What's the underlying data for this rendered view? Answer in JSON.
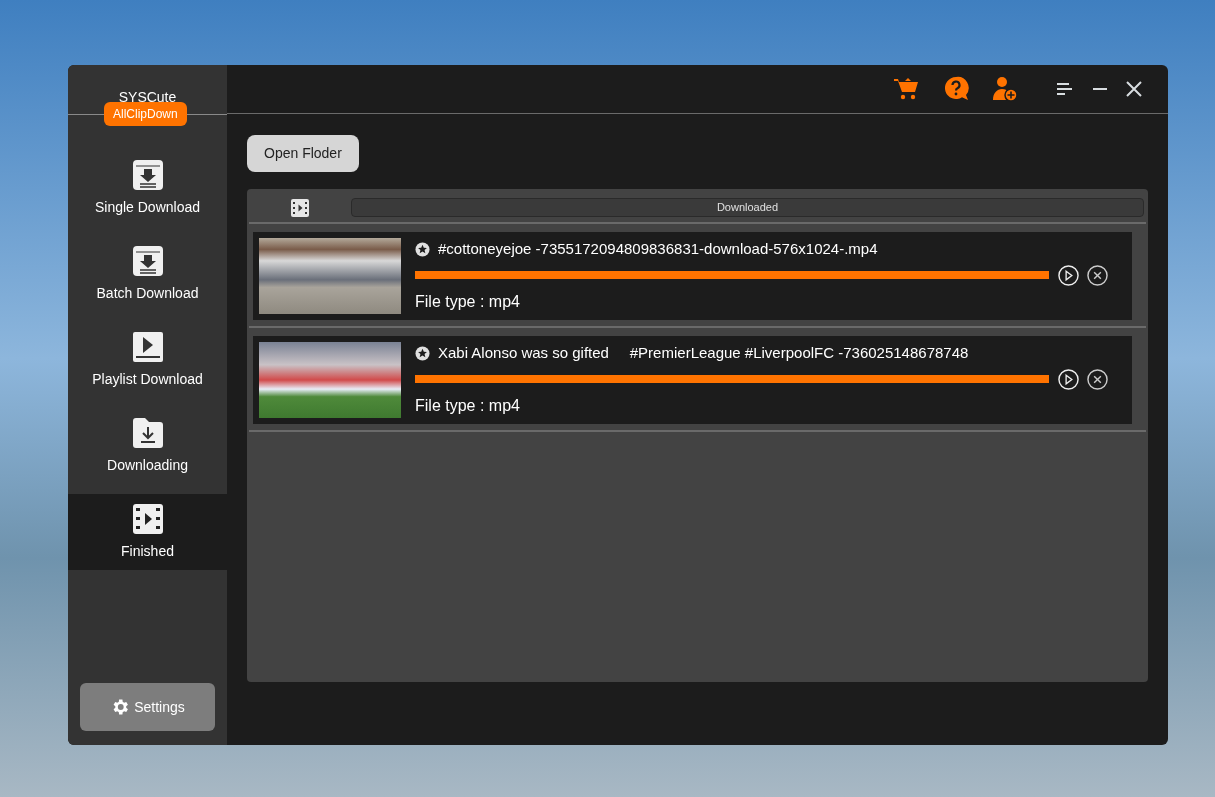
{
  "brand": {
    "name": "SYSCute",
    "product": "AllClipDown"
  },
  "nav": [
    {
      "label": "Single Download",
      "kind": "single",
      "selected": false
    },
    {
      "label": "Batch Download",
      "kind": "batch",
      "selected": false
    },
    {
      "label": "Playlist Download",
      "kind": "playlist",
      "selected": false
    },
    {
      "label": "Downloading",
      "kind": "downloading",
      "selected": false
    },
    {
      "label": "Finished",
      "kind": "finished",
      "selected": true
    }
  ],
  "settings": {
    "label": "Settings"
  },
  "toolbar": {
    "open_folder": "Open Floder"
  },
  "list": {
    "header": "Downloaded",
    "items": [
      {
        "title": "#cottoneyejoe -7355172094809836831-download-576x1024-.mp4",
        "level": 1,
        "file_type": "File type : mp4"
      },
      {
        "title": "Xabi Alonso was so gifted     #PremierLeague #LiverpoolFC -736025148678748",
        "level": 1,
        "file_type": "File type : mp4"
      }
    ]
  }
}
